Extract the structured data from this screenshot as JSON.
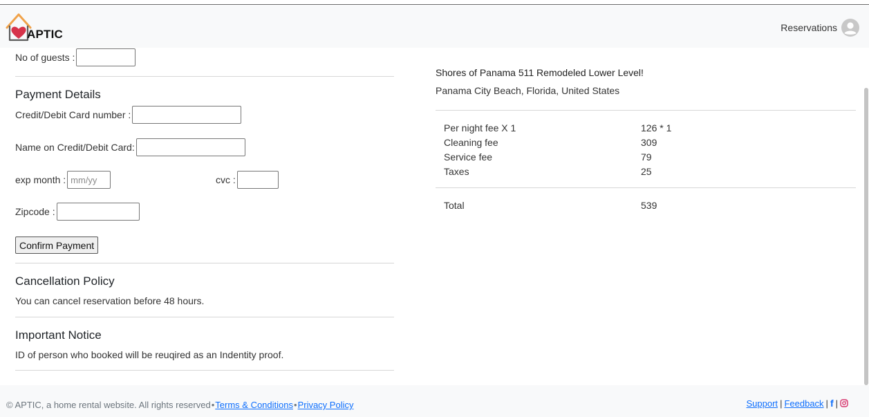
{
  "header": {
    "brand": "APTIC",
    "nav_reservations": "Reservations"
  },
  "booking": {
    "guests_label": "No of guests :",
    "guests_value": ""
  },
  "payment": {
    "title": "Payment Details",
    "card_number_label": "Credit/Debit Card number :",
    "card_number_value": "",
    "name_label": "Name on Credit/Debit Card:",
    "name_value": "",
    "exp_label": "exp month :",
    "exp_placeholder": "mm/yy",
    "cvc_label": "cvc :",
    "zip_label": "Zipcode :",
    "confirm_button": "Confirm Payment"
  },
  "cancellation": {
    "title": "Cancellation Policy",
    "text": "You can cancel reservation before 48 hours."
  },
  "notice": {
    "title": "Important Notice",
    "text": "ID of person who booked will be reuqired as an Indentity proof."
  },
  "listing": {
    "title": "Shores of Panama 511 Remodeled Lower Level!",
    "location": "Panama City Beach, Florida, United States"
  },
  "fees": [
    {
      "label": "Per night fee X 1",
      "value": "126 * 1"
    },
    {
      "label": "Cleaning fee",
      "value": "309"
    },
    {
      "label": "Service fee",
      "value": "79"
    },
    {
      "label": "Taxes",
      "value": "25"
    }
  ],
  "total": {
    "label": "Total",
    "value": "539"
  },
  "footer": {
    "copyright": "© APTIC, a home rental website. All rights reserved",
    "terms": "Terms & Conditions",
    "privacy": "Privacy Policy",
    "support": "Support",
    "feedback": "Feedback",
    "separator": "|",
    "bullet": "•",
    "facebook_glyph": "f"
  },
  "colors": {
    "link": "#0d6efd",
    "logo_orange": "#f0a24a",
    "logo_heart": "#d6334a",
    "instagram": "#d6336c"
  },
  "icons": [
    "house-heart-logo-icon",
    "user-avatar-icon",
    "facebook-icon",
    "instagram-icon"
  ]
}
